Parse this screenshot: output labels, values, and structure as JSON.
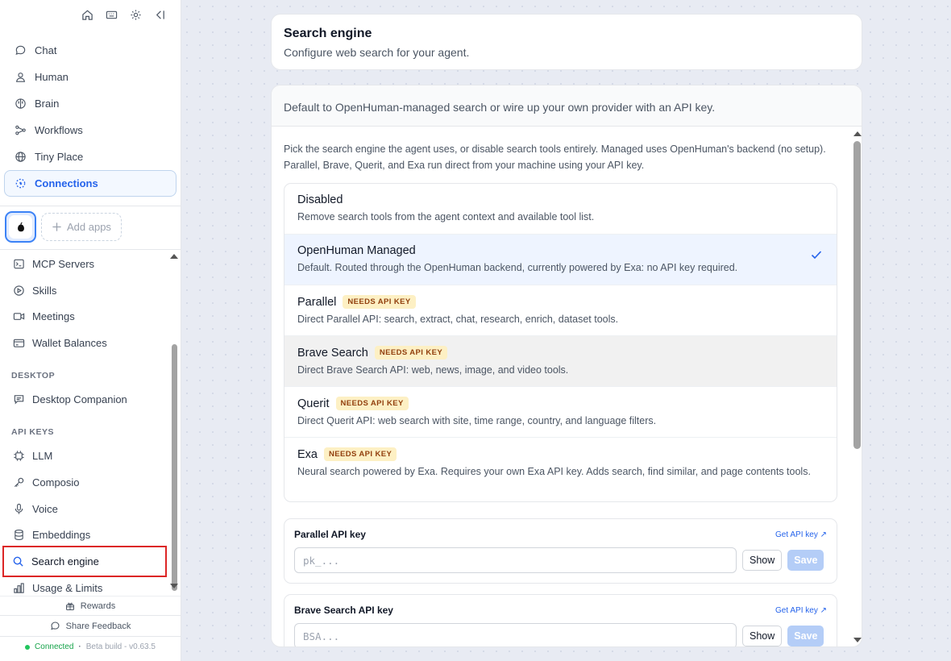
{
  "sidebar": {
    "top_icons": [
      "home-icon",
      "keyboard-icon",
      "gear-icon",
      "collapse-sidebar-icon"
    ],
    "nav": [
      {
        "label": "Chat",
        "icon": "chat-bubble-icon"
      },
      {
        "label": "Human",
        "icon": "user-icon"
      },
      {
        "label": "Brain",
        "icon": "brain-icon"
      },
      {
        "label": "Workflows",
        "icon": "workflow-icon"
      },
      {
        "label": "Tiny Place",
        "icon": "globe-icon"
      },
      {
        "label": "Connections",
        "icon": "connections-icon",
        "active": true
      }
    ],
    "add_apps_label": "Add apps",
    "items_top": [
      {
        "label": "MCP Servers",
        "icon": "terminal-icon"
      },
      {
        "label": "Skills",
        "icon": "play-circle-icon"
      },
      {
        "label": "Meetings",
        "icon": "video-icon"
      },
      {
        "label": "Wallet Balances",
        "icon": "wallet-icon"
      }
    ],
    "desktop_heading": "DESKTOP",
    "desktop_items": [
      {
        "label": "Desktop Companion",
        "icon": "message-square-icon"
      }
    ],
    "api_keys_heading": "API KEYS",
    "api_items": [
      {
        "label": "LLM",
        "icon": "cpu-icon"
      },
      {
        "label": "Composio",
        "icon": "key-icon"
      },
      {
        "label": "Voice",
        "icon": "microphone-icon"
      },
      {
        "label": "Embeddings",
        "icon": "database-icon"
      },
      {
        "label": "Search engine",
        "icon": "search-icon",
        "selected": true
      },
      {
        "label": "Usage & Limits",
        "icon": "bar-chart-icon"
      }
    ],
    "rewards_label": "Rewards",
    "feedback_label": "Share Feedback",
    "status_label": "Connected",
    "status_separator": "·",
    "build_label": "Beta build - v0.63.5"
  },
  "header": {
    "title": "Search engine",
    "subtitle": "Configure web search for your agent."
  },
  "panel": {
    "description": "Default to OpenHuman-managed search or wire up your own provider with an API key.",
    "intro": "Pick the search engine the agent uses, or disable search tools entirely. Managed uses OpenHuman's backend (no setup). Parallel, Brave, Querit, and Exa run direct from your machine using your API key.",
    "engines": [
      {
        "name": "Disabled",
        "badge": "",
        "desc": "Remove search tools from the agent context and available tool list."
      },
      {
        "name": "OpenHuman Managed",
        "badge": "",
        "desc": "Default. Routed through the OpenHuman backend, currently powered by Exa: no API key required.",
        "selected": true
      },
      {
        "name": "Parallel",
        "badge": "NEEDS API KEY",
        "desc": "Direct Parallel API: search, extract, chat, research, enrich, dataset tools."
      },
      {
        "name": "Brave Search",
        "badge": "NEEDS API KEY",
        "desc": "Direct Brave Search API: web, news, image, and video tools."
      },
      {
        "name": "Querit",
        "badge": "NEEDS API KEY",
        "desc": "Direct Querit API: web search with site, time range, country, and language filters."
      },
      {
        "name": "Exa",
        "badge": "NEEDS API KEY",
        "desc": "Neural search powered by Exa. Requires your own Exa API key. Adds search, find similar, and page contents tools."
      }
    ],
    "keys": [
      {
        "title": "Parallel API key",
        "link": "Get API key ↗",
        "placeholder": "pk_...",
        "show": "Show",
        "save": "Save"
      },
      {
        "title": "Brave Search API key",
        "link": "Get API key ↗",
        "placeholder": "BSA...",
        "show": "Show",
        "save": "Save"
      }
    ]
  },
  "colors": {
    "accent": "#2563eb",
    "highlight_border": "#dc2626",
    "badge_bg": "#fdf0c4",
    "status_green": "#22c55e"
  }
}
